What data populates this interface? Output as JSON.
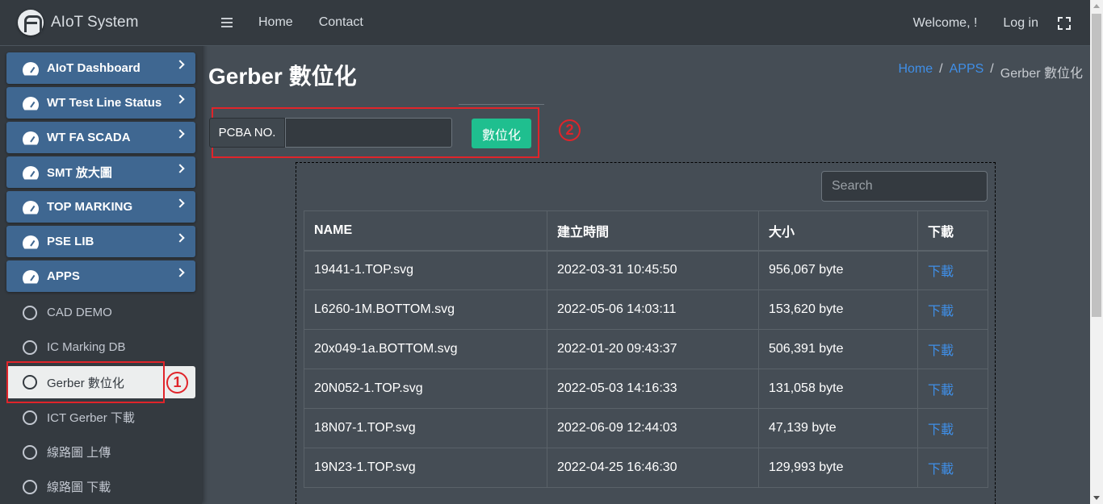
{
  "brand": {
    "name": "AIoT System"
  },
  "sidebar": {
    "menu": [
      {
        "label": "AIoT Dashboard"
      },
      {
        "label": "WT Test Line Status"
      },
      {
        "label": "WT FA SCADA"
      },
      {
        "label": "SMT 放大圖"
      },
      {
        "label": "TOP MARKING"
      },
      {
        "label": "PSE LIB"
      },
      {
        "label": "APPS"
      }
    ],
    "sub": [
      {
        "label": "CAD DEMO"
      },
      {
        "label": "IC Marking DB"
      },
      {
        "label": "Gerber 數位化"
      },
      {
        "label": "ICT Gerber 下載"
      },
      {
        "label": "線路圖 上傳"
      },
      {
        "label": "線路圖 下載"
      }
    ]
  },
  "navbar": {
    "home": "Home",
    "contact": "Contact",
    "welcome": "Welcome, !",
    "login": "Log in"
  },
  "page": {
    "title": "Gerber 數位化"
  },
  "breadcrumb": {
    "home": "Home",
    "apps": "APPS",
    "current": "Gerber 數位化",
    "sep": "/"
  },
  "form": {
    "pcba_label": "PCBA NO.",
    "pcba_value": "",
    "button": "數位化"
  },
  "annotations": {
    "one": "1",
    "two": "2"
  },
  "search": {
    "placeholder": "Search"
  },
  "table": {
    "headers": [
      "NAME",
      "建立時間",
      "大小",
      "下載"
    ],
    "rows": [
      [
        "19441-1.TOP.svg",
        "2022-03-31 10:45:50",
        "956,067 byte",
        "下載"
      ],
      [
        "L6260-1M.BOTTOM.svg",
        "2022-05-06 14:03:11",
        "153,620 byte",
        "下載"
      ],
      [
        "20x049-1a.BOTTOM.svg",
        "2022-01-20 09:43:37",
        "506,391 byte",
        "下載"
      ],
      [
        "20N052-1.TOP.svg",
        "2022-05-03 14:16:33",
        "131,058 byte",
        "下載"
      ],
      [
        "18N07-1.TOP.svg",
        "2022-06-09 12:44:03",
        "47,139 byte",
        "下載"
      ],
      [
        "19N23-1.TOP.svg",
        "2022-04-25 16:46:30",
        "129,993 byte",
        "下載"
      ]
    ]
  },
  "colors": {
    "accent": "#1fbf8f",
    "menu": "#3f6791",
    "link": "#3f8fe8",
    "annotation": "#e0242a"
  }
}
